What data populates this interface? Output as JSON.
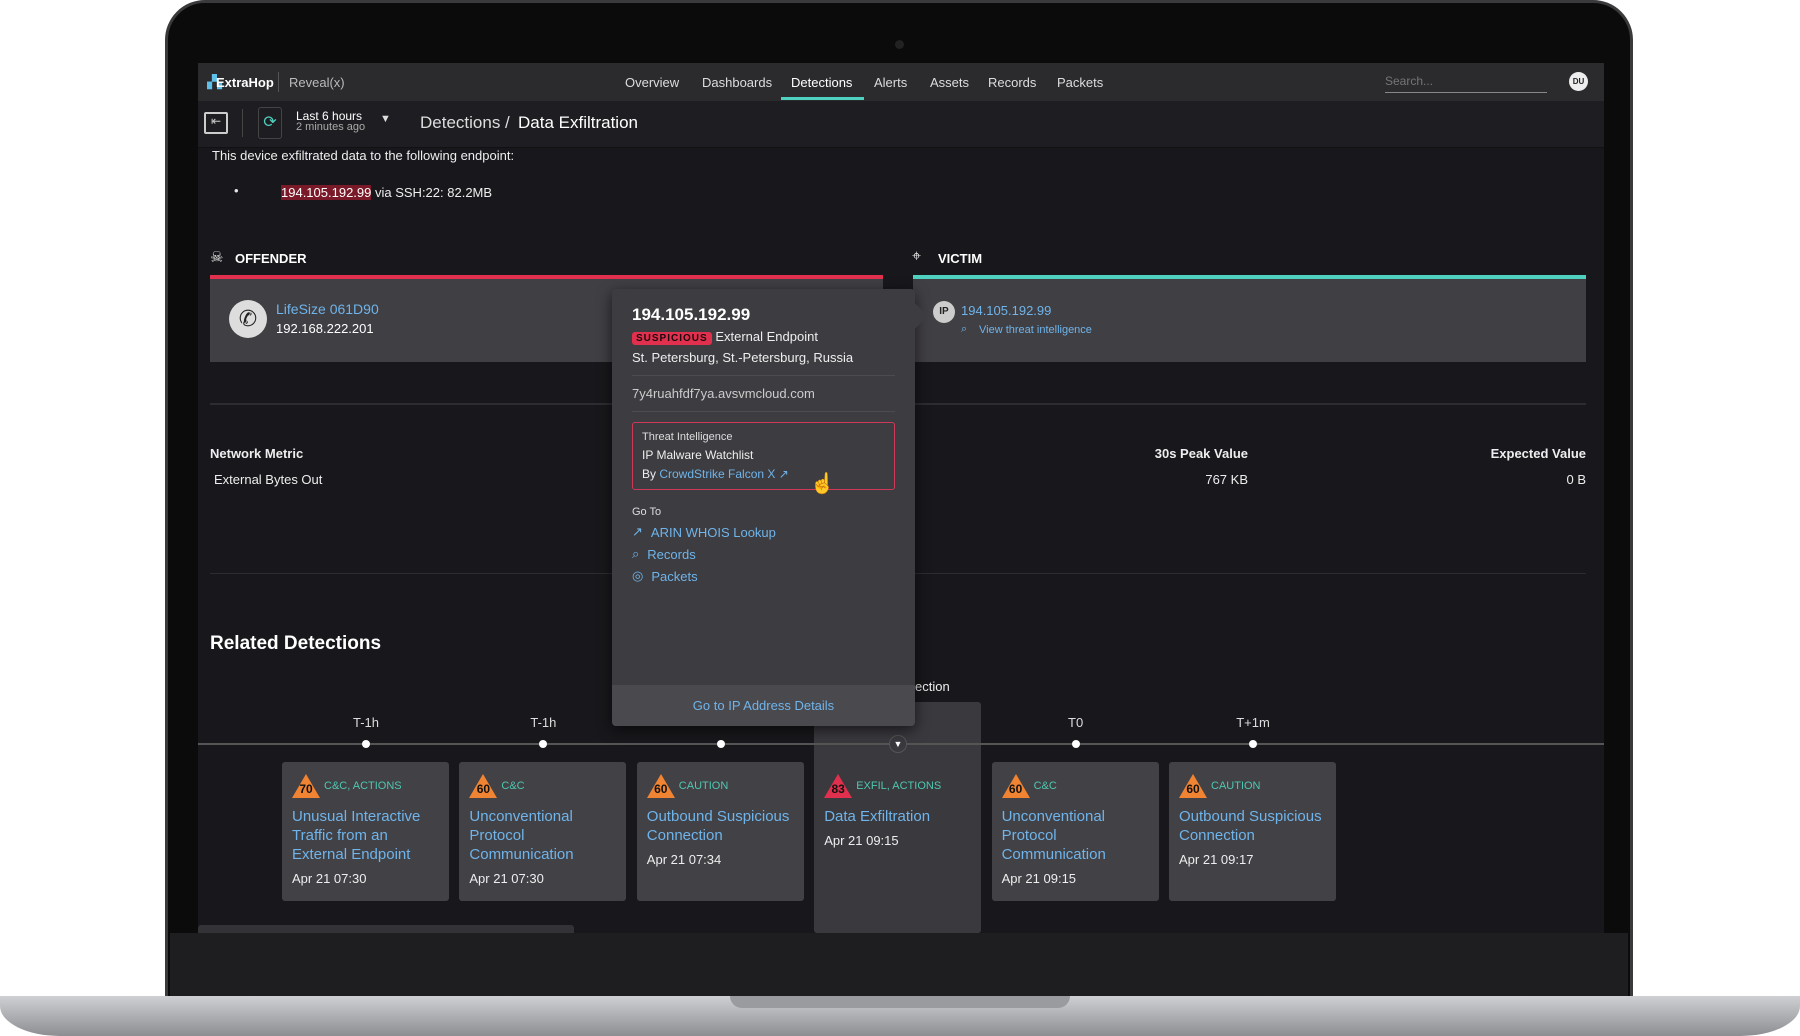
{
  "nav": {
    "brand": "ExtraHop",
    "product": "Reveal(x)",
    "items": [
      "Overview",
      "Dashboards",
      "Detections",
      "Alerts",
      "Assets",
      "Records",
      "Packets"
    ],
    "active": "Detections",
    "search_placeholder": "Search...",
    "avatar": "DU"
  },
  "subbar": {
    "time_range": "Last 6 hours",
    "updated": "2 minutes ago",
    "breadcrumb_parent": "Detections",
    "breadcrumb_sep": "/",
    "breadcrumb_current": "Data Exfiltration"
  },
  "summary": {
    "intro": "This device exfiltrated data to the following endpoint:",
    "ip": "194.105.192.99",
    "detail": " via SSH:22: 82.2MB"
  },
  "offender": {
    "header": "OFFENDER",
    "name": "LifeSize 061D90",
    "ip": "192.168.222.201",
    "color": "#e0304e"
  },
  "victim": {
    "header": "VICTIM",
    "ip": "194.105.192.99",
    "threat_link": "View threat intelligence",
    "color": "#4fd1c0"
  },
  "metrics": {
    "col1": "Network Metric",
    "col2": "30s Peak Value",
    "col3": "Expected Value",
    "row": {
      "metric": "External Bytes Out",
      "peak": "767 KB",
      "expected": "0 B"
    }
  },
  "popup": {
    "ip": "194.105.192.99",
    "badge": "SUSPICIOUS",
    "type": "External Endpoint",
    "location": "St. Petersburg, St.-Petersburg, Russia",
    "hostname": "7y4ruahfdf7ya.avsvmcloud.com",
    "ti_title": "Threat Intelligence",
    "ti_list": "IP Malware Watchlist",
    "ti_by": "By ",
    "ti_source": "CrowdStrike Falcon X",
    "goto": "Go To",
    "links": [
      "ARIN WHOIS Lookup",
      "Records",
      "Packets"
    ],
    "footer": "Go to IP Address Details"
  },
  "related": {
    "title": "Related Detections",
    "selected_label_fragment": "ection",
    "time_labels": [
      "T-1h",
      "T-1h",
      "",
      "",
      "T0",
      "T+1m"
    ],
    "cards": [
      {
        "score": "70",
        "category": "C&C, ACTIONS",
        "name": "Unusual Interactive Traffic from an External Endpoint",
        "date": "Apr 21 07:30",
        "color": "#f08432"
      },
      {
        "score": "60",
        "category": "C&C",
        "name": "Unconventional Protocol Communication",
        "date": "Apr 21 07:30",
        "color": "#f08432"
      },
      {
        "score": "60",
        "category": "CAUTION",
        "name": "Outbound Suspicious Connection",
        "date": "Apr 21 07:34",
        "color": "#f08432"
      },
      {
        "score": "83",
        "category": "EXFIL, ACTIONS",
        "name": "Data Exfiltration",
        "date": "Apr 21 09:15",
        "color": "#e0304e"
      },
      {
        "score": "60",
        "category": "C&C",
        "name": "Unconventional Protocol Communication",
        "date": "Apr 21 09:15",
        "color": "#f08432"
      },
      {
        "score": "60",
        "category": "CAUTION",
        "name": "Outbound Suspicious Connection",
        "date": "Apr 21 09:17",
        "color": "#f08432"
      }
    ]
  }
}
